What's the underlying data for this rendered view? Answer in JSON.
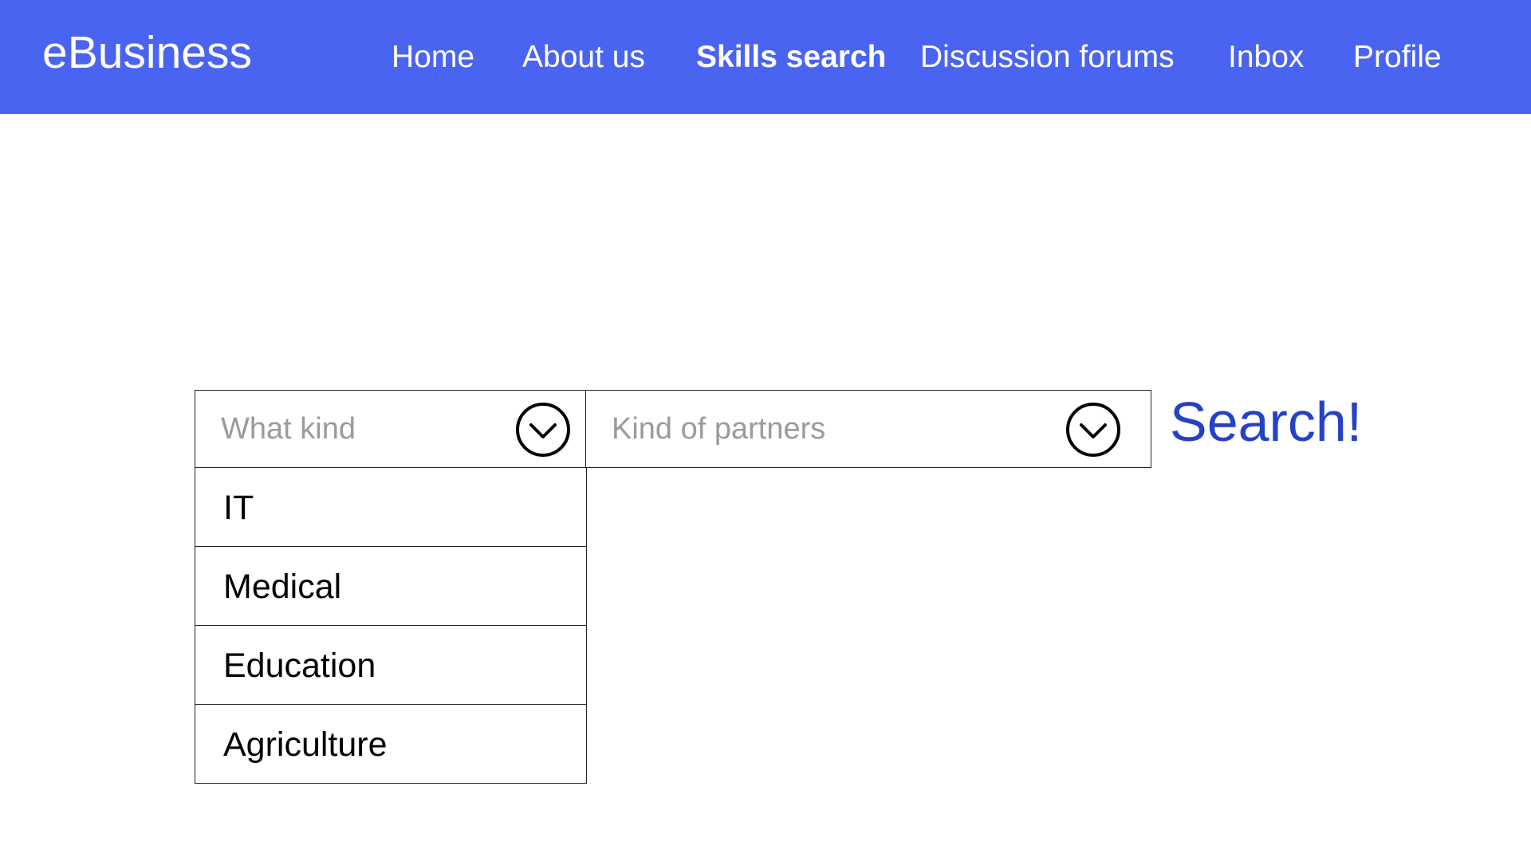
{
  "header": {
    "brand": "eBusiness",
    "background_color": "#4a64f2",
    "nav": [
      {
        "label": "Home",
        "active": false
      },
      {
        "label": "About us",
        "active": false
      },
      {
        "label": "Skills search",
        "active": true
      },
      {
        "label": "Discussion forums",
        "active": false
      },
      {
        "label": "Inbox",
        "active": false
      },
      {
        "label": "Profile",
        "active": false
      }
    ]
  },
  "search": {
    "what_kind": {
      "placeholder": "What kind",
      "icon": "chevron-down-circle-icon",
      "expanded": true,
      "options": [
        "IT",
        "Medical",
        "Education",
        "Agriculture"
      ]
    },
    "partners": {
      "placeholder": "Kind of partners",
      "icon": "chevron-down-circle-icon",
      "expanded": false
    },
    "search_label": "Search!",
    "search_color": "#2541c8"
  }
}
